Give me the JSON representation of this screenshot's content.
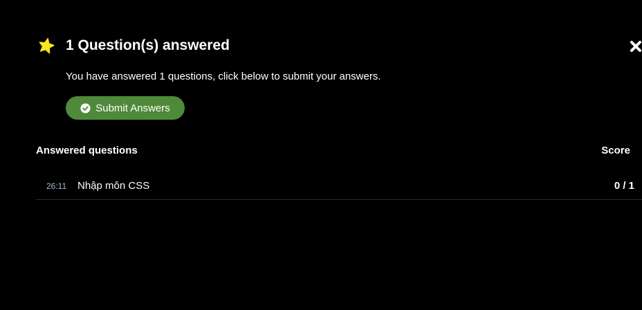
{
  "header": {
    "title": "1 Question(s) answered",
    "star_color": "#f5e61f"
  },
  "message": "You have answered 1 questions, click below to submit your answers.",
  "submit_button": {
    "label": "Submit Answers",
    "color": "#4f8a3a"
  },
  "table": {
    "left_header": "Answered questions",
    "right_header": "Score",
    "rows": [
      {
        "time": "26:11",
        "title": "Nhập môn CSS",
        "score": "0 / 1"
      }
    ]
  }
}
